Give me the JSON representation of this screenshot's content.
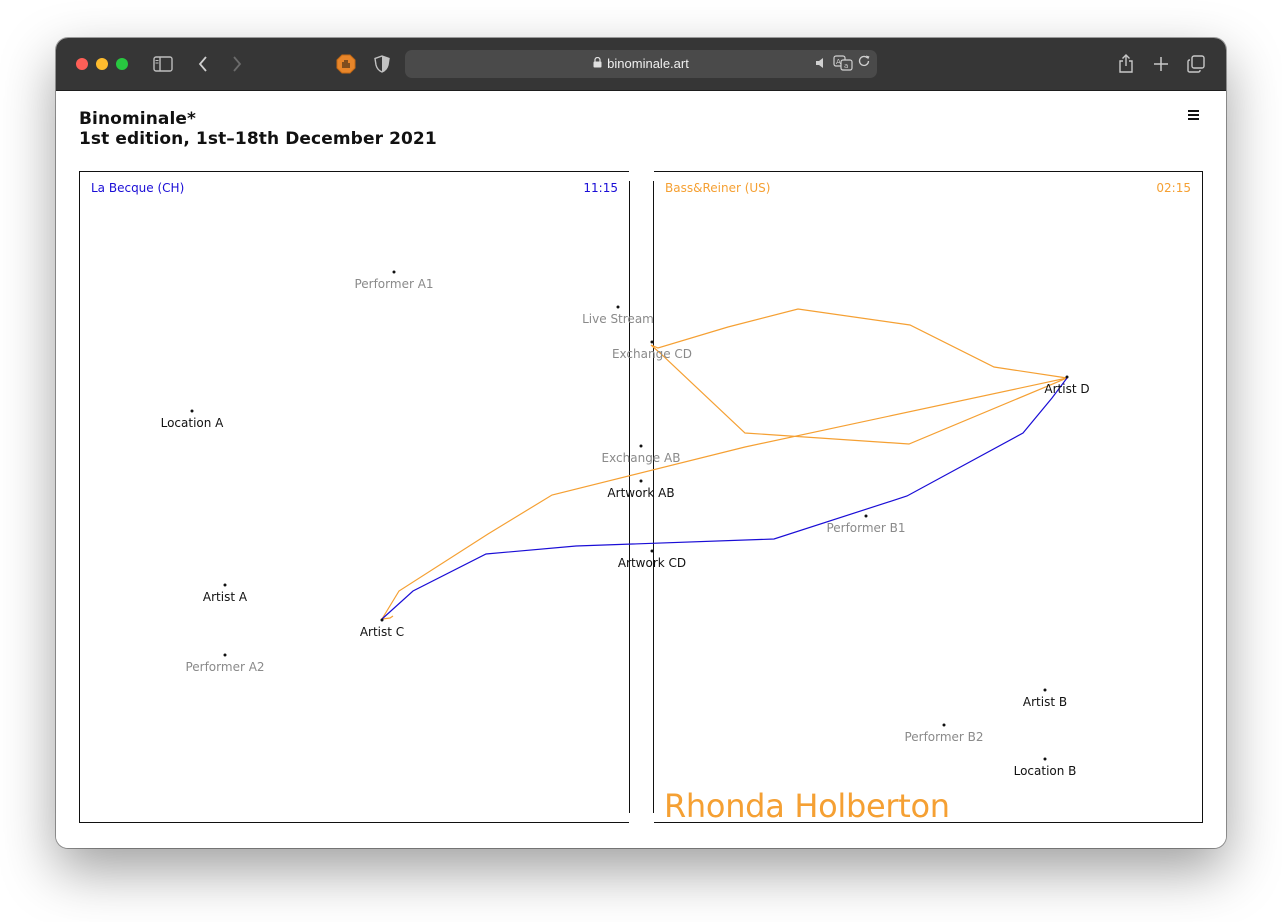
{
  "browser": {
    "url": "binominale.art",
    "icons": [
      "sidebar-icon",
      "back-icon",
      "forward-icon",
      "extension-icon",
      "shield-icon",
      "lock-icon",
      "mute-icon",
      "translate-icon",
      "reload-icon",
      "share-icon",
      "new-tab-icon",
      "tabs-overview-icon"
    ]
  },
  "site": {
    "title": "Binominale*",
    "subtitle": "1st edition, 1st–18th December 2021",
    "menu_icon": "hamburger-menu-icon"
  },
  "panels": {
    "left": {
      "venue": "La Becque (CH)",
      "time": "11:15",
      "color": "#1a0dd6"
    },
    "right": {
      "venue": "Bass&Reiner (US)",
      "time": "02:15",
      "color": "#f5a033"
    }
  },
  "artist": {
    "name": "Rhonda Holberton",
    "color": "#f5a033"
  },
  "nodes": [
    {
      "id": "performer-a1",
      "label": "Performer A1",
      "kind": "secondary"
    },
    {
      "id": "live-stream",
      "label": "Live Stream",
      "kind": "secondary"
    },
    {
      "id": "exchange-cd",
      "label": "Exchange CD",
      "kind": "secondary"
    },
    {
      "id": "artist-d",
      "label": "Artist D",
      "kind": "primary"
    },
    {
      "id": "location-a",
      "label": "Location A",
      "kind": "primary"
    },
    {
      "id": "exchange-ab",
      "label": "Exchange AB",
      "kind": "secondary"
    },
    {
      "id": "artwork-ab",
      "label": "Artwork AB",
      "kind": "primary"
    },
    {
      "id": "performer-b1",
      "label": "Performer B1",
      "kind": "secondary"
    },
    {
      "id": "artwork-cd",
      "label": "Artwork CD",
      "kind": "primary"
    },
    {
      "id": "artist-a",
      "label": "Artist A",
      "kind": "primary"
    },
    {
      "id": "artist-c",
      "label": "Artist C",
      "kind": "primary"
    },
    {
      "id": "performer-a2",
      "label": "Performer A2",
      "kind": "secondary"
    },
    {
      "id": "artist-b",
      "label": "Artist B",
      "kind": "primary"
    },
    {
      "id": "performer-b2",
      "label": "Performer B2",
      "kind": "secondary"
    },
    {
      "id": "location-b",
      "label": "Location B",
      "kind": "primary"
    }
  ],
  "paths": [
    {
      "name": "orange-trajectory",
      "color": "#f5a033"
    },
    {
      "name": "blue-trajectory",
      "color": "#1a0dd6"
    }
  ]
}
